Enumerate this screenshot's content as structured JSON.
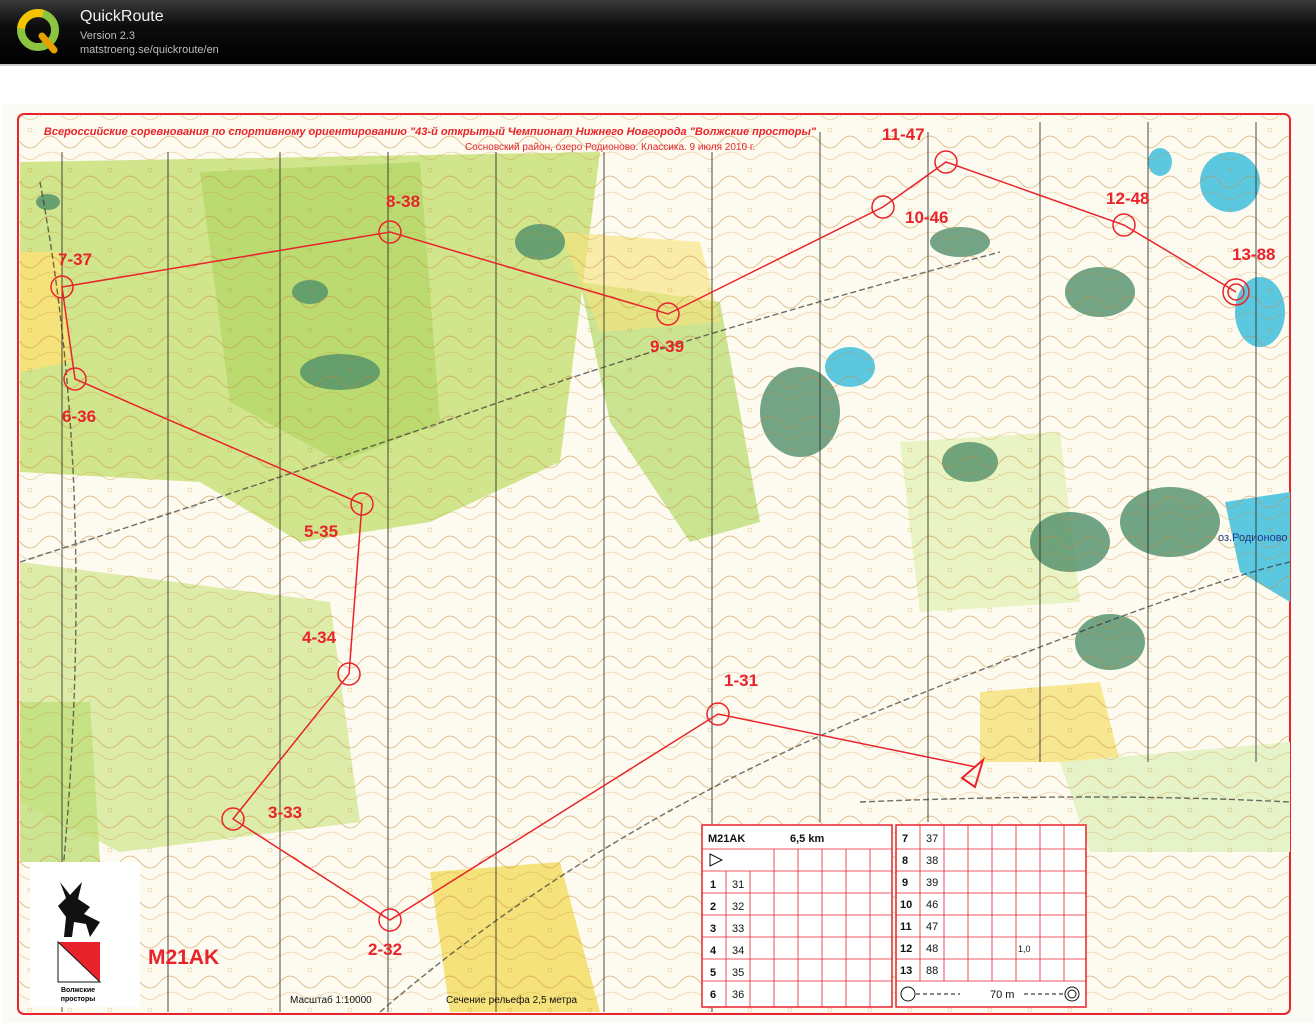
{
  "app": {
    "name": "QuickRoute",
    "version": "Version 2.3",
    "url": "matstroeng.se/quickroute/en",
    "icon": "quickroute-q-logo"
  },
  "map": {
    "header_line1": "Всероссийские соревнования по спортивному ориентированию  \"43-й открытый Чемпионат Нижнего Новгорода \"Волжские просторы\"",
    "header_line2": "Сосновский район, озеро Родионово. Классика. 9 июля 2010 г.",
    "class_label": "M21AK",
    "scale": "Масштаб 1:10000",
    "contour": "Сечение рельефа 2,5 метра",
    "lake_name": "оз.Родионово",
    "logo_caption_1": "Волжские",
    "logo_caption_2": "просторы",
    "controls": [
      {
        "label": "1-31"
      },
      {
        "label": "2-32"
      },
      {
        "label": "3-33"
      },
      {
        "label": "4-34"
      },
      {
        "label": "5-35"
      },
      {
        "label": "6-36"
      },
      {
        "label": "7-37"
      },
      {
        "label": "8-38"
      },
      {
        "label": "9-39"
      },
      {
        "label": "10-46"
      },
      {
        "label": "11-47"
      },
      {
        "label": "12-48"
      },
      {
        "label": "13-88"
      }
    ],
    "colors": {
      "course": "#e8232b",
      "forest": "#c9e07a",
      "open": "#f6e27a",
      "water": "#5cc8e0",
      "marsh": "#4f8f6a"
    }
  },
  "description_sheet": {
    "class": "M21AK",
    "length": "6,5 km",
    "left_rows": [
      {
        "num": "1",
        "code": "31"
      },
      {
        "num": "2",
        "code": "32"
      },
      {
        "num": "3",
        "code": "33"
      },
      {
        "num": "4",
        "code": "34"
      },
      {
        "num": "5",
        "code": "35"
      },
      {
        "num": "6",
        "code": "36"
      }
    ],
    "right_rows": [
      {
        "num": "7",
        "code": "37"
      },
      {
        "num": "8",
        "code": "38"
      },
      {
        "num": "9",
        "code": "39"
      },
      {
        "num": "10",
        "code": "46"
      },
      {
        "num": "11",
        "code": "47"
      },
      {
        "num": "12",
        "code": "48"
      },
      {
        "num": "13",
        "code": "88"
      }
    ],
    "finish": "70 m",
    "dim": "1,0"
  }
}
